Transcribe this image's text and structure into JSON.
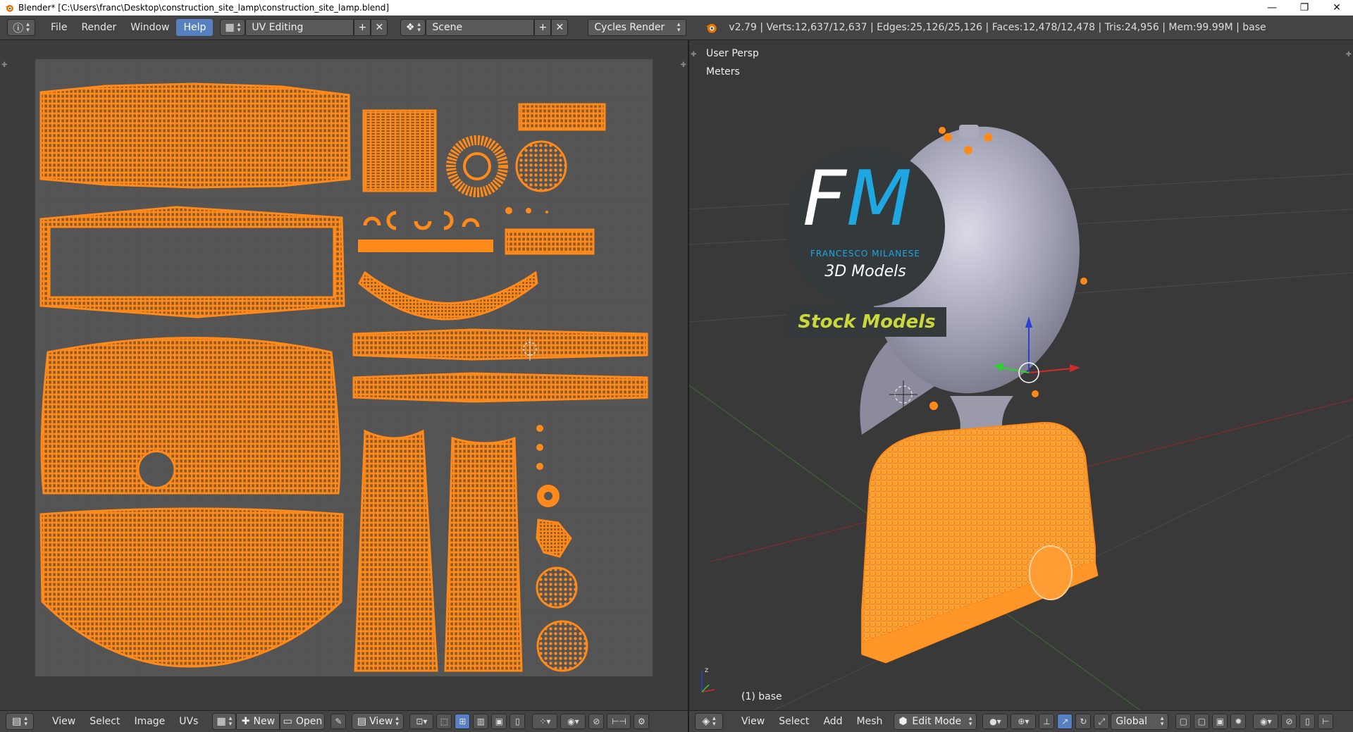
{
  "window": {
    "title": "Blender* [C:\\Users\\franc\\Desktop\\construction_site_lamp\\construction_site_lamp.blend]",
    "minimize": "—",
    "maximize": "❐",
    "close": "✕"
  },
  "info_header": {
    "menus": [
      "File",
      "Render",
      "Window",
      "Help"
    ],
    "active_menu": "Help",
    "screen_layout": "UV Editing",
    "scene": "Scene",
    "render_engine": "Cycles Render",
    "stats": "v2.79 | Verts:12,637/12,637 | Edges:25,126/25,126 | Faces:12,478/12,478 | Tris:24,956 | Mem:99.99M | base"
  },
  "viewport": {
    "view_name": "User Persp",
    "units": "Meters",
    "object_label": "(1) base",
    "watermark": {
      "monogram_f": "F",
      "monogram_m": "M",
      "author": "FRANCESCO MILANESE",
      "subtitle": "3D Models",
      "banner": "Stock Models"
    }
  },
  "uv_footer": {
    "menus": [
      "View",
      "Select",
      "Image",
      "UVs"
    ],
    "new_label": "New",
    "open_label": "Open",
    "view_label": "View"
  },
  "view3d_footer": {
    "menus": [
      "View",
      "Select",
      "Add",
      "Mesh"
    ],
    "mode": "Edit Mode",
    "orientation": "Global"
  },
  "colors": {
    "accent": "#5680c2",
    "uv_orange": "#ff8a1a",
    "wire_dark": "#4a2f12"
  }
}
